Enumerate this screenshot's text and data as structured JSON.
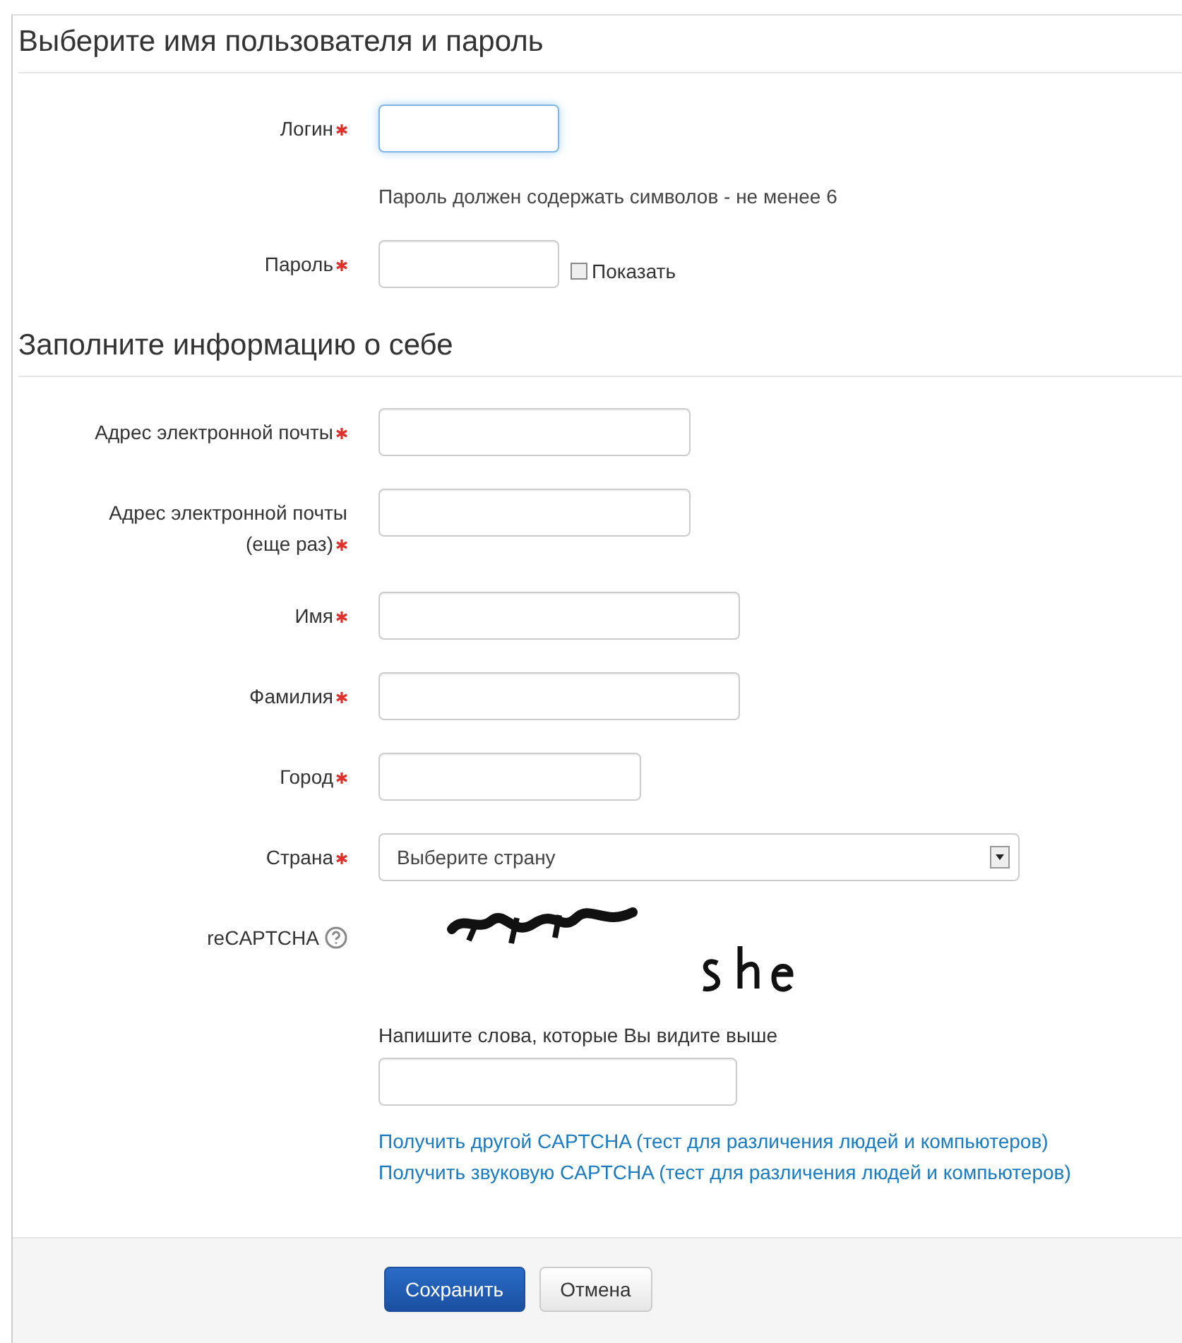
{
  "sections": [
    {
      "title": "Выберите имя пользователя и пароль",
      "rows": [
        {
          "kind": "input",
          "label": "Логин",
          "required": true,
          "focused": true
        },
        {
          "kind": "note",
          "text": "Пароль должен содержать символов - не менее 6"
        },
        {
          "kind": "password",
          "label": "Пароль",
          "required": true,
          "focused": false,
          "show": {
            "label": "Показать",
            "checked": false
          }
        }
      ]
    },
    {
      "title": "Заполните информацию о себе",
      "rows": [
        {
          "kind": "input",
          "label": "Адрес электронной почты",
          "required": true,
          "focused": false
        },
        {
          "kind": "input",
          "label": "Адрес электронной почты (еще раз)",
          "required": true,
          "focused": false
        },
        {
          "kind": "input",
          "label": "Имя",
          "required": true,
          "focused": false
        },
        {
          "kind": "input",
          "label": "Фамилия",
          "required": true,
          "focused": false
        },
        {
          "kind": "input",
          "label": "Город",
          "required": true,
          "focused": false
        },
        {
          "kind": "select",
          "label": "Страна",
          "required": true,
          "value": "Выберите страну"
        },
        {
          "kind": "captcha",
          "label": "reCAPTCHA",
          "instruction": "Напишите слова, которые Вы видите выше",
          "links": [
            "Получить другой CAPTCHA (тест для различения людей и компьютеров)",
            "Получить звуковую CAPTCHA (тест для различения людей и компьютеров)"
          ]
        }
      ]
    }
  ],
  "buttons": [
    {
      "label": "Сохранить",
      "primary": true
    },
    {
      "label": "Отмена",
      "primary": false
    }
  ]
}
